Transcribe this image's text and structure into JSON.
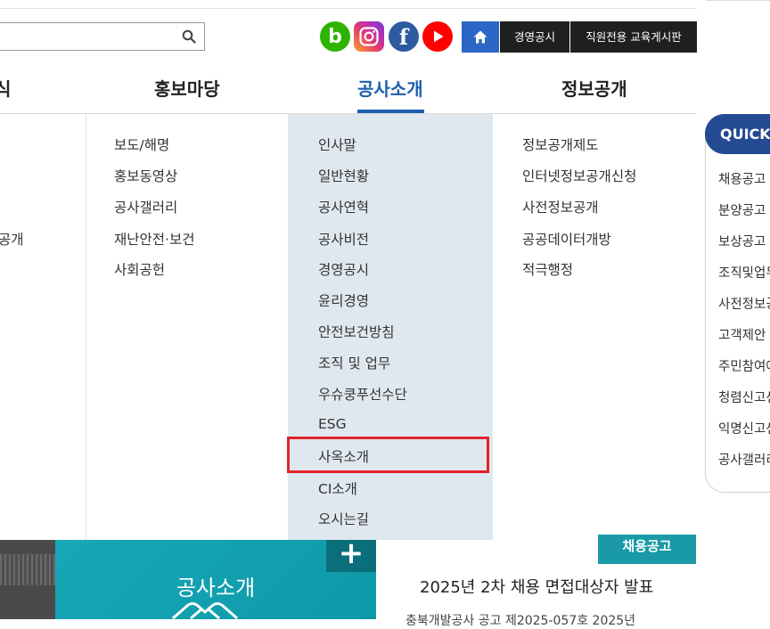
{
  "search": {
    "value": "",
    "placeholder": "",
    "icon": "search-icon"
  },
  "sns": {
    "blog_letter": "b",
    "facebook_letter": "f"
  },
  "top_links": [
    "경영공시",
    "직원전용 교육게시판"
  ],
  "gnb": [
    {
      "label": "식",
      "active": false
    },
    {
      "label": "홍보마당",
      "active": false
    },
    {
      "label": "공사소개",
      "active": true
    },
    {
      "label": "정보공개",
      "active": false
    }
  ],
  "submenu": {
    "col0": [
      "공개"
    ],
    "col1": [
      "보도/해명",
      "홍보동영상",
      "공사갤러리",
      "재난안전·보건",
      "사회공헌"
    ],
    "col2": [
      "인사말",
      "일반현황",
      "공사연혁",
      "공사비전",
      "경영공시",
      "윤리경영",
      "안전보건방침",
      "조직 및 업무",
      "우슈쿵푸선수단",
      "ESG",
      "사옥소개",
      "CI소개",
      "오시는길"
    ],
    "col3": [
      "정보공개제도",
      "인터넷정보공개신청",
      "사전정보공개",
      "공공데이터개방",
      "적극행정"
    ],
    "highlighted": "사옥소개"
  },
  "quick": {
    "title": "QUICK MENU",
    "items": [
      "채용공고",
      "분양공고",
      "보상공고",
      "조직및업무",
      "사전정보공개",
      "고객제안",
      "주민참여예산",
      "청렴신고센터",
      "익명신고센터",
      "공사갤러리"
    ]
  },
  "banner": {
    "title": "공사소개",
    "plus": "+"
  },
  "news": {
    "tag": "채용공고",
    "title": "2025년 2차 채용 면접대상자 발표",
    "sub": "충북개발공사 공고 제2025-057호 2025년"
  },
  "colors": {
    "accent": "#1e5fb0",
    "highlight": "#e2232a",
    "quick": "#234a93",
    "teal": "#16a8b6"
  }
}
